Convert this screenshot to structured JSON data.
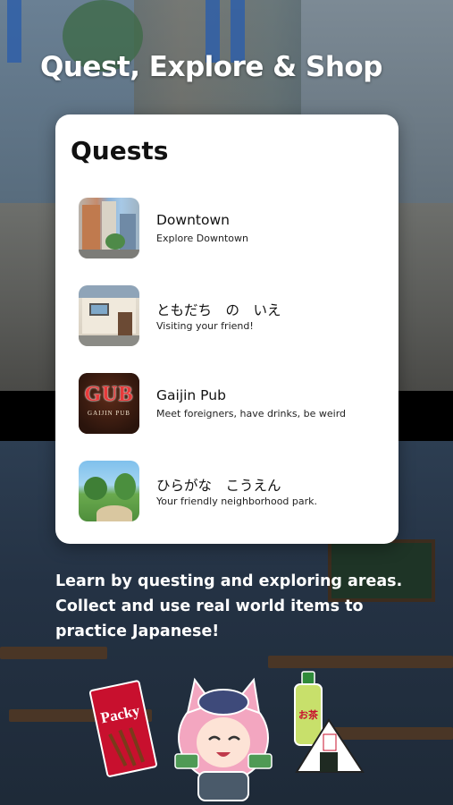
{
  "header": {
    "title": "Quest, Explore & Shop"
  },
  "card": {
    "heading": "Quests",
    "quests": [
      {
        "name": "Downtown",
        "description": "Explore Downtown",
        "thumb_icon": "downtown-thumbnail"
      },
      {
        "name": "ともだち　の　いえ",
        "description": "Visiting your friend!",
        "thumb_icon": "friend-house-thumbnail"
      },
      {
        "name": "Gaijin Pub",
        "description": "Meet foreigners, have drinks, be weird",
        "thumb_icon": "gaijin-pub-thumbnail",
        "thumb_text": "GUB",
        "thumb_subtext": "GAIJIN PUB"
      },
      {
        "name": "ひらがな　こうえん",
        "description": "Your friendly neighborhood park.",
        "thumb_icon": "park-thumbnail"
      }
    ]
  },
  "description": "Learn by questing and exploring areas. Collect and use real world items to practice Japanese!",
  "illustration": {
    "snack_label": "Packy",
    "tea_label": "お茶"
  },
  "colors": {
    "card_background": "#ffffff",
    "text_primary": "#111111",
    "text_on_background": "#ffffff"
  }
}
